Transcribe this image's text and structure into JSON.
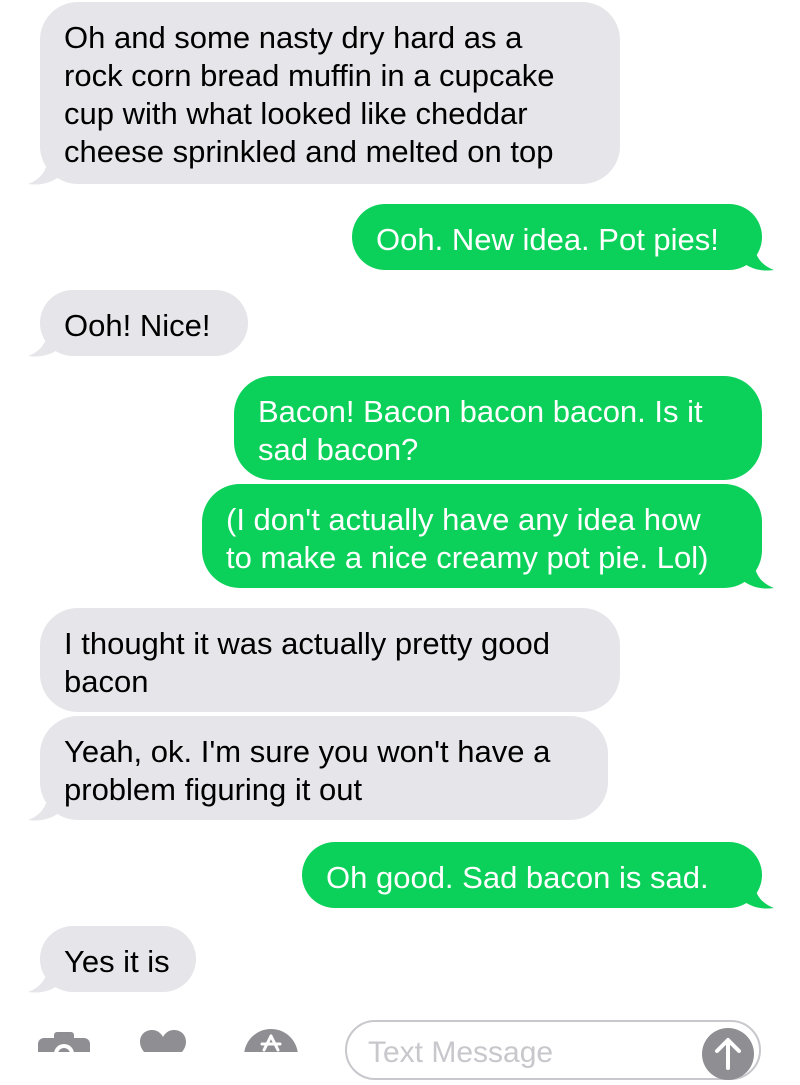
{
  "colors": {
    "received_bubble": "#e5e5ea",
    "sent_bubble": "#0bd15a",
    "icon_gray": "#8e8e93"
  },
  "messages": [
    {
      "direction": "received",
      "text": "Oh and some nasty dry hard as a\nrock corn bread muffin in a cupcake\ncup with what looked like cheddar\ncheese sprinkled and melted on top"
    },
    {
      "direction": "sent",
      "text": "Ooh. New idea. Pot pies!"
    },
    {
      "direction": "received",
      "text": "Ooh! Nice!"
    },
    {
      "direction": "sent",
      "text": "Bacon! Bacon bacon bacon. Is it\nsad bacon?"
    },
    {
      "direction": "sent",
      "text": "(I don't actually have any idea how\nto make a nice creamy pot pie. Lol)"
    },
    {
      "direction": "received",
      "text": "I thought it was actually pretty good\nbacon"
    },
    {
      "direction": "received",
      "text": "Yeah, ok. I'm sure you won't have a\nproblem figuring it out"
    },
    {
      "direction": "sent",
      "text": "Oh good. Sad bacon is sad."
    },
    {
      "direction": "received",
      "text": "Yes it is"
    }
  ],
  "input_bar": {
    "placeholder": "Text Message",
    "icons": [
      "camera-icon",
      "digital-touch-icon",
      "app-store-icon",
      "send-arrow-icon"
    ]
  }
}
